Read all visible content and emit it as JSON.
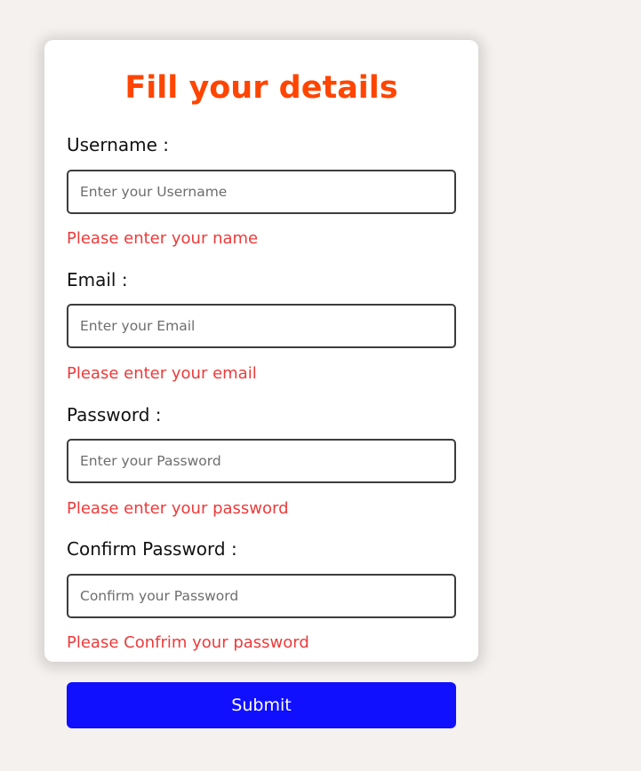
{
  "form": {
    "title": "Fill your details",
    "fields": [
      {
        "label": "Username :",
        "placeholder": "Enter your Username",
        "value": "",
        "error": "Please enter your name"
      },
      {
        "label": "Email :",
        "placeholder": "Enter your Email",
        "value": "",
        "error": "Please enter your email"
      },
      {
        "label": "Password :",
        "placeholder": "Enter your Password",
        "value": "",
        "error": "Please enter your password"
      },
      {
        "label": "Confirm Password :",
        "placeholder": "Confirm your Password",
        "value": "",
        "error": "Please Confrim your password"
      }
    ],
    "submit_label": "Submit"
  },
  "colors": {
    "background": "#f5f1ef",
    "card": "#ffffff",
    "title": "#ff4500",
    "error": "#ee3a3a",
    "submit_bg": "#1010ff",
    "submit_text": "#ffffff"
  }
}
